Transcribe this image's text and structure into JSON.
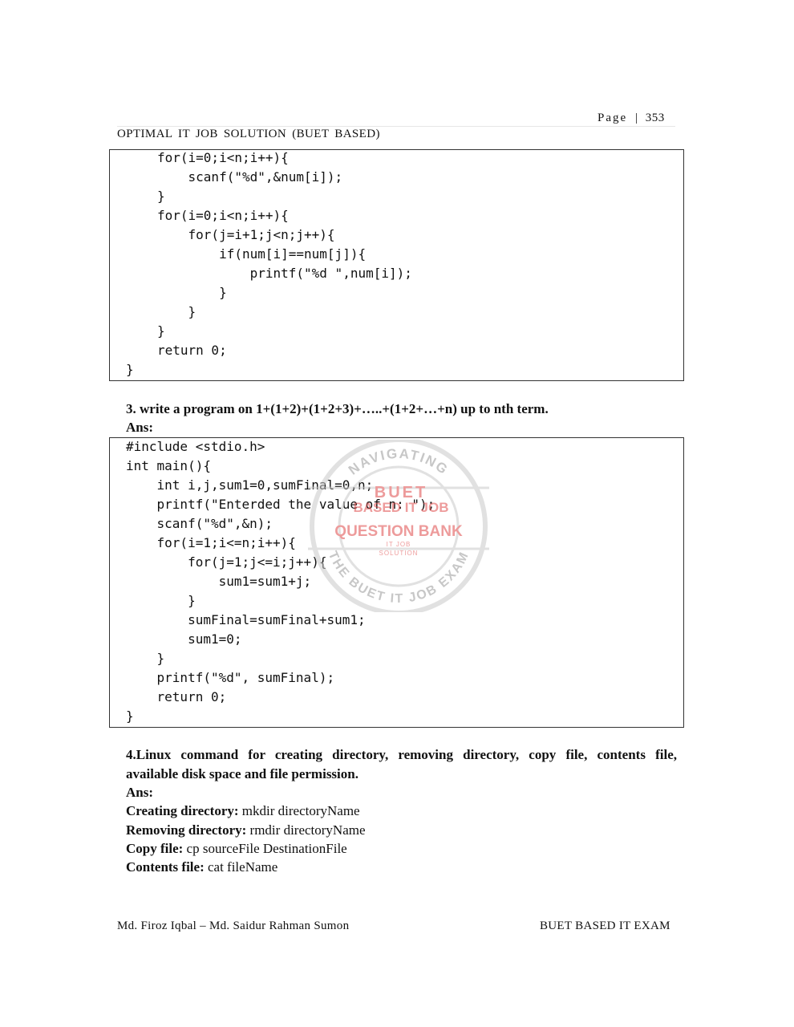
{
  "header": {
    "page_label": "Page",
    "separator": "|",
    "page_number": "353",
    "running_title": "OPTIMAL IT JOB SOLUTION (BUET BASED)"
  },
  "code_block_1": [
    "for(i=0;i<n;i++){",
    "    scanf(\"%d\",&num[i]);",
    "}",
    "for(i=0;i<n;i++){",
    "    for(j=i+1;j<n;j++){",
    "        if(num[i]==num[j]){",
    "            printf(\"%d \",num[i]);",
    "        }",
    "    }",
    "}",
    "return 0;",
    "}"
  ],
  "question_3": {
    "title": "3. write a program on 1+(1+2)+(1+2+3)+…..+(1+2+…+n) up to nth term.",
    "ans_label": "Ans:"
  },
  "code_block_2": [
    "#include <stdio.h>",
    "int main(){",
    "    int i,j,sum1=0,sumFinal=0,n;",
    "    printf(\"Enterded the value of n: \");",
    "    scanf(\"%d\",&n);",
    "    for(i=1;i<=n;i++){",
    "        for(j=1;j<=i;j++){",
    "            sum1=sum1+j;",
    "        }",
    "        sumFinal=sumFinal+sum1;",
    "        sum1=0;",
    "    }",
    "    printf(\"%d\", sumFinal);",
    "    return 0;",
    "}"
  ],
  "stamp": {
    "top_arc": "NAVIGATING",
    "line1": "BUET",
    "line2": "BASED IT JOB",
    "line3": "QUESTION BANK",
    "line4": "IT JOB",
    "line5": "SOLUTION",
    "bottom_arc": "THE BUET IT JOB EXAM",
    "color": "#e04b4b"
  },
  "question_4": {
    "title_line1": "4.Linux command for creating directory, removing directory, copy file, contents file,",
    "title_line2": "available disk space and file permission.",
    "ans_label": "Ans:",
    "items": [
      {
        "label": "Creating directory:",
        "value": " mkdir directoryName"
      },
      {
        "label": "Removing directory:",
        "value": " rmdir directoryName"
      },
      {
        "label": "Copy file:",
        "value": " cp sourceFile DestinationFile"
      },
      {
        "label": "Contents file:",
        "value": " cat fileName"
      }
    ]
  },
  "footer": {
    "authors": "Md. Firoz Iqbal – Md. Saidur Rahman Sumon",
    "series": "BUET BASED IT EXAM"
  }
}
